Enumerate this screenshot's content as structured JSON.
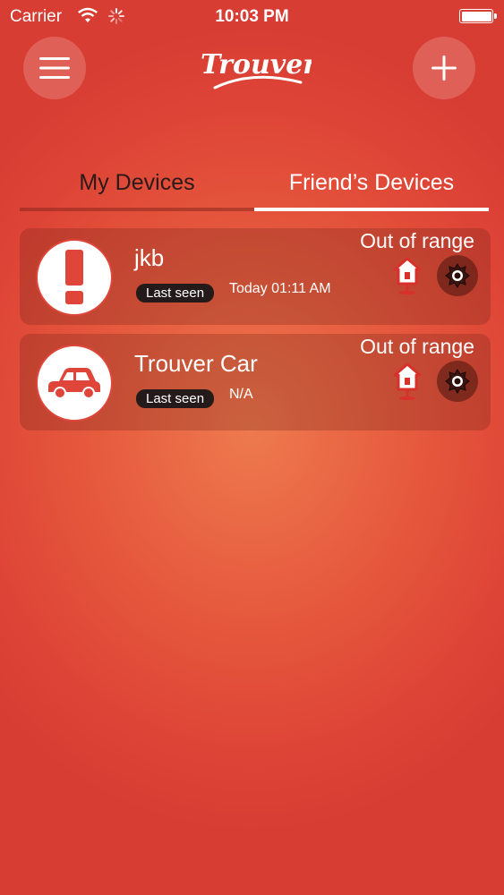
{
  "status_bar": {
    "carrier": "Carrier",
    "time": "10:03 PM"
  },
  "header": {
    "logo_text": "Trouver",
    "menu_icon": "hamburger-menu-icon",
    "add_icon": "plus-icon"
  },
  "tabs": [
    {
      "label": "My Devices",
      "active": false
    },
    {
      "label": "Friend’s Devices",
      "active": true
    }
  ],
  "devices": [
    {
      "name": "jkb",
      "avatar_icon": "exclamation-icon",
      "last_seen_label": "Last seen",
      "last_seen_value": "Today 01:11 AM",
      "status": "Out of range",
      "location_icon": "home-pin-icon",
      "alarm_icon": "alarm-icon"
    },
    {
      "name": "Trouver Car",
      "avatar_icon": "car-icon",
      "last_seen_label": "Last seen",
      "last_seen_value": "N/A",
      "status": "Out of range",
      "location_icon": "home-pin-icon",
      "alarm_icon": "alarm-icon"
    }
  ],
  "colors": {
    "background_center": "#ee7a4e",
    "background_edge": "#d83d33",
    "accent_red": "#e0453a",
    "badge_bg": "#241a1a"
  }
}
